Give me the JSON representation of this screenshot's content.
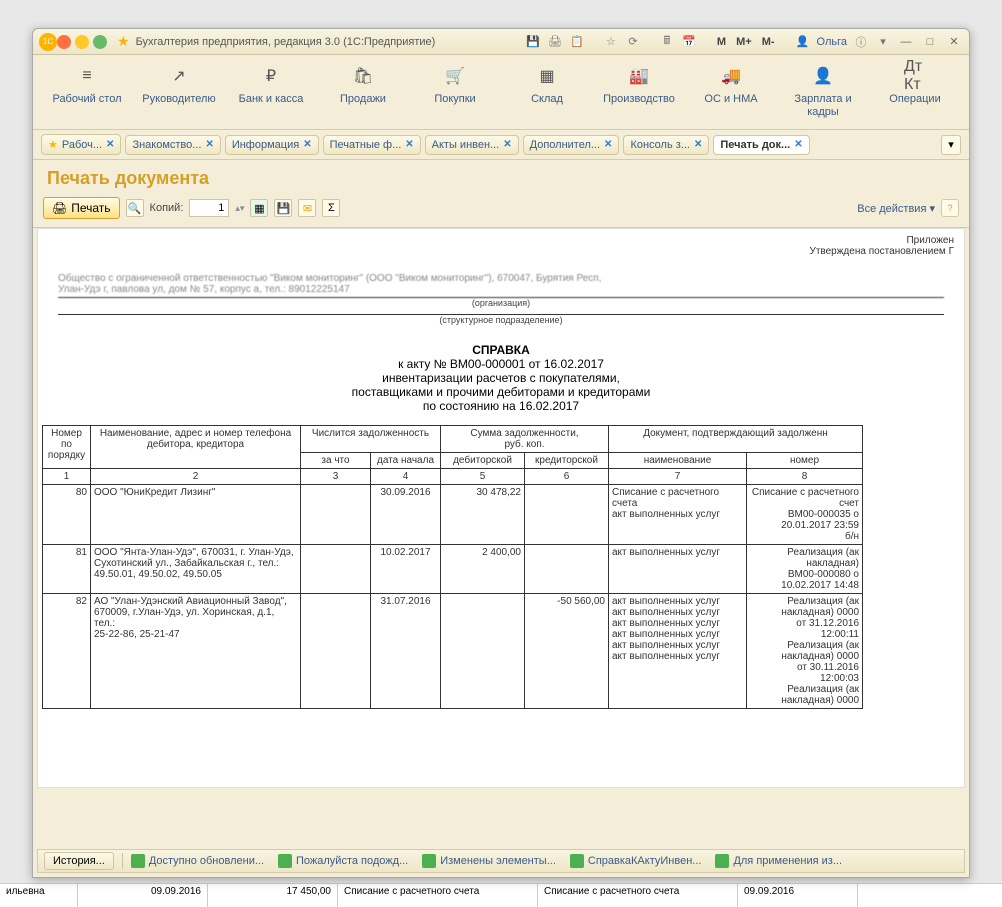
{
  "titlebar": {
    "title": "Бухгалтерия предприятия, редакция 3.0   (1С:Предприятие)",
    "user": "Ольга",
    "m": "M",
    "mplus": "M+",
    "mminus": "M-"
  },
  "maintoolbar": [
    {
      "icon": "≡",
      "label": "Рабочий стол"
    },
    {
      "icon": "↗",
      "label": "Руководителю"
    },
    {
      "icon": "₽",
      "label": "Банк и касса"
    },
    {
      "icon": "🛍",
      "label": "Продажи"
    },
    {
      "icon": "🛒",
      "label": "Покупки"
    },
    {
      "icon": "▦",
      "label": "Склад"
    },
    {
      "icon": "🏭",
      "label": "Производство"
    },
    {
      "icon": "🚚",
      "label": "ОС и НМА"
    },
    {
      "icon": "👤",
      "label": "Зарплата и кадры"
    },
    {
      "icon": "Дт Кт",
      "label": "Операции"
    }
  ],
  "tabs": [
    {
      "label": "Рабоч...",
      "active": false,
      "star": true
    },
    {
      "label": "Знакомство...",
      "active": false
    },
    {
      "label": "Информация",
      "active": false
    },
    {
      "label": "Печатные ф...",
      "active": false
    },
    {
      "label": "Акты инвен...",
      "active": false
    },
    {
      "label": "Дополнител...",
      "active": false
    },
    {
      "label": "Консоль з...",
      "active": false
    },
    {
      "label": "Печать док...",
      "active": true
    }
  ],
  "doc": {
    "title": "Печать документа",
    "print_label": "Печать",
    "copies_label": "Копий:",
    "copies_value": "1",
    "all_actions": "Все действия ▾"
  },
  "report": {
    "approved": "Приложен\nУтверждена постановлением Г",
    "org_line": "Общество с ограниченной ответственностью \"Виком мониторинг\" (ООО \"Виком мониторинг\"), 670047, Бурятия Респ,\nУлан-Удэ г, павлова ул, дом № 57, корпус а, тел.: 89012225147",
    "org_sub": "(организация)",
    "struct_sub": "(структурное подразделение)",
    "s_title": "СПРАВКА",
    "s_line1": "к акту № ВМ00-000001 от 16.02.2017",
    "s_line2": "инвентаризации расчетов с покупателями,",
    "s_line3": "поставщиками и прочими дебиторами и кредиторами",
    "s_line4": "по состоянию на 16.02.2017"
  },
  "table": {
    "headers": {
      "col1": "Номер по порядку",
      "col2": "Наименование, адрес и номер телефона дебитора, кредитора",
      "grp3": "Числится задолженность",
      "col3a": "за что",
      "col3b": "дата начала",
      "grp4": "Сумма задолженности,\nруб. коп.",
      "col4a": "дебиторской",
      "col4b": "кредиторской",
      "grp5": "Документ, подтверждающий задолженн",
      "col5a": "наименование",
      "col5b": "номер"
    },
    "numrow": [
      "1",
      "2",
      "3",
      "4",
      "5",
      "6",
      "7",
      "8"
    ],
    "rows": [
      {
        "n": "80",
        "name": "ООО \"ЮниКредит Лизинг\"",
        "za": "",
        "date": "30.09.2016",
        "deb": "30 478,22",
        "kred": "",
        "doc": "Списание с расчетного счета\nакт выполненных услуг",
        "num": "Списание с расчетного счет\nВМ00-000035 о\n20.01.2017 23:59\nб/н"
      },
      {
        "n": "81",
        "name": "ООО \"Янта-Улан-Удэ\", 670031, г. Улан-Удэ,\nСухотинский ул., Забайкальская г., тел.:\n49.50.01, 49.50.02, 49.50.05",
        "za": "",
        "date": "10.02.2017",
        "deb": "2 400,00",
        "kred": "",
        "doc": "акт выполненных услуг",
        "num": "Реализация (ак\nнакладная)\nВМ00-000080 о\n10.02.2017 14:48"
      },
      {
        "n": "82",
        "name": "АО \"Улан-Удэнский Авиационный Завод\",\n670009, г.Улан-Удэ, ул. Хоринская, д.1, тел.:\n25-22-86, 25-21-47",
        "za": "",
        "date": "31.07.2016",
        "deb": "",
        "kred": "-50 560,00",
        "doc": "акт выполненных услуг\nакт выполненных услуг\nакт выполненных услуг\nакт выполненных услуг\nакт выполненных услуг\nакт выполненных услуг",
        "num": "Реализация (ак\nнакладная) 0000\nот 31.12.2016\n12:00:11\nРеализация (ак\nнакладная) 0000\nот 30.11.2016\n12:00:03\nРеализация (ак\nнакладная) 0000"
      }
    ]
  },
  "statusbar": {
    "history": "История...",
    "items": [
      "Доступно обновлени...",
      "Пожалуйста подожд...",
      "Изменены элементы...",
      "СправкаКАктуИнвен...",
      "Для применения из..."
    ]
  },
  "bgrow": {
    "c1": "ильевна",
    "c2": "09.09.2016",
    "c3": "17 450,00",
    "c4": "Списание с расчетного счета",
    "c5": "Списание с расчетного счета",
    "c6": "09.09.2016"
  }
}
